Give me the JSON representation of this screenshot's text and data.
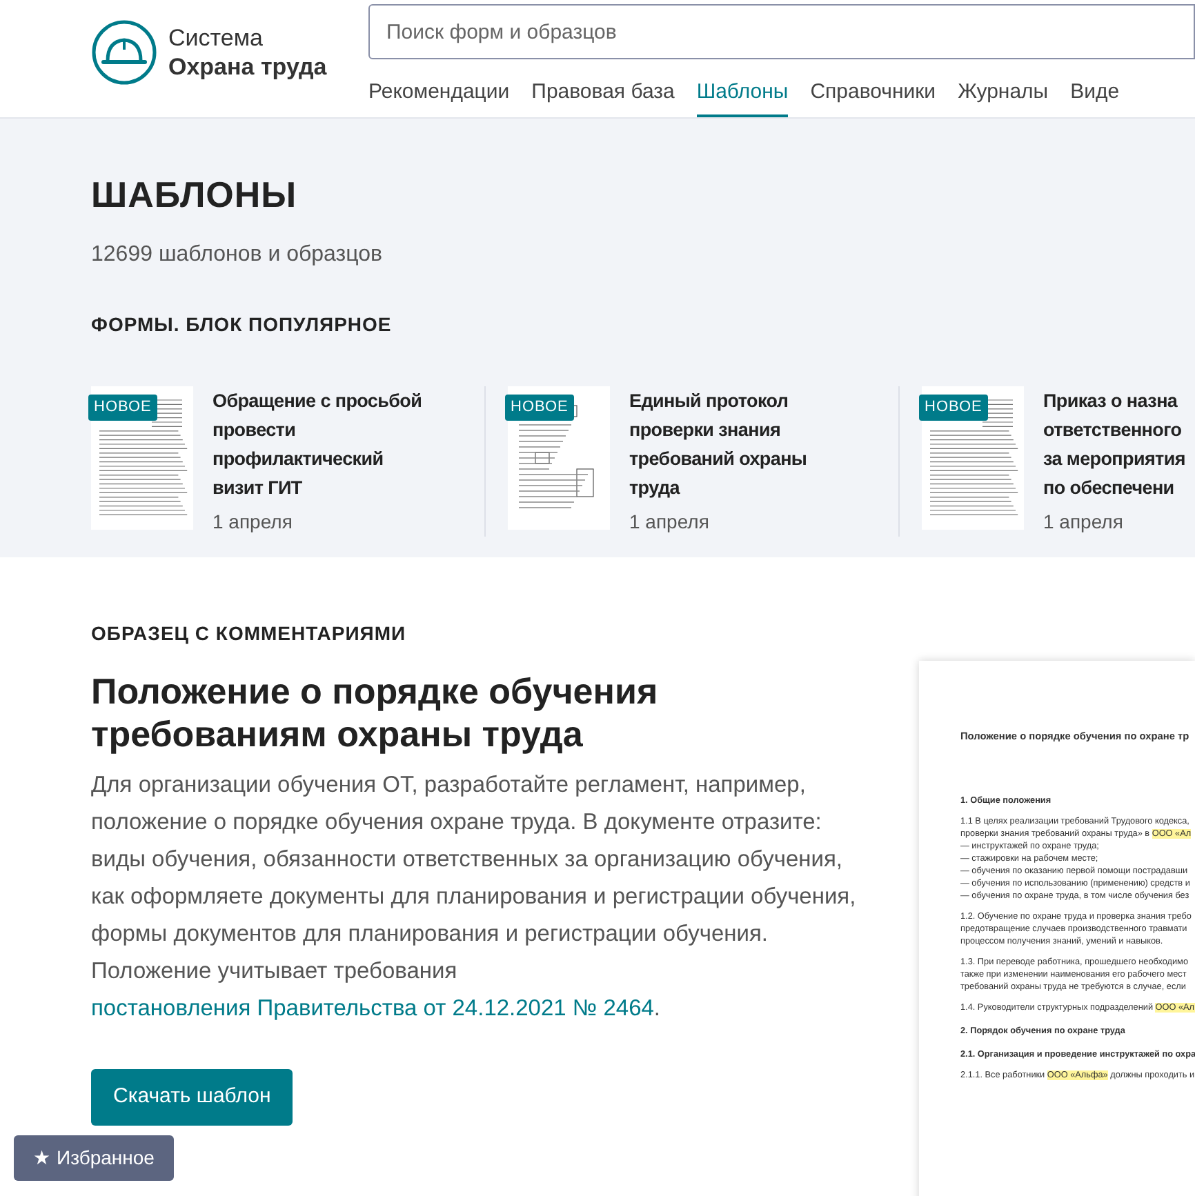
{
  "logo": {
    "line_1": "Система",
    "line_2": "Охрана труда"
  },
  "search": {
    "placeholder": "Поиск форм и образцов"
  },
  "nav": [
    {
      "label": "Рекомендации",
      "selected": false
    },
    {
      "label": "Правовая база",
      "selected": false
    },
    {
      "label": "Шаблоны",
      "selected": true
    },
    {
      "label": "Справочники",
      "selected": false
    },
    {
      "label": "Журналы",
      "selected": false
    },
    {
      "label": "Виде",
      "selected": false
    }
  ],
  "hero": {
    "title": "ШАБЛОНЫ",
    "count": "12699 шаблонов и образцов",
    "section_title": "ФОРМЫ. БЛОК ПОПУЛЯРНОЕ"
  },
  "cards": [
    {
      "badge": "НОВОЕ",
      "title_lines": [
        "Обращение с просьбой",
        "провести",
        "профилактический",
        "визит ГИТ"
      ],
      "date": "1 апреля",
      "kind": "letter"
    },
    {
      "badge": "НОВОЕ",
      "title_lines": [
        "Единый протокол",
        "проверки знания",
        "требований охраны",
        "труда"
      ],
      "date": "1 апреля",
      "kind": "form"
    },
    {
      "badge": "НОВОЕ",
      "title_lines": [
        "Приказ о назна",
        "ответственного",
        "за мероприятия",
        "по обеспечени"
      ],
      "date": "1 апреля",
      "kind": "letter"
    }
  ],
  "sample": {
    "label": "ОБРАЗЕЦ С КОММЕНТАРИЯМИ",
    "title": "Положение о порядке обучения требованиям охраны труда",
    "text": "Для организации обучения ОТ, разработайте регламент, например, положение о порядке обучения охране труда. В документе отразите: виды обучения, обязанности ответственных за организацию обучения, как оформляете документы для планирования и регистрации обучения, формы документов для планирования и регистрации обучения. Положение учитывает требования ",
    "link": "постановления Правительства от 24.12.2021 № 2464",
    "text_end": ".",
    "button": "Скачать шаблон"
  },
  "document": [
    {
      "kind": "title",
      "parts": [
        {
          "text": "Положение о порядке обучения по охране тр",
          "highlight": false
        }
      ]
    },
    {
      "kind": "heading",
      "parts": [
        {
          "text": "1. Общие положения",
          "highlight": false
        }
      ]
    },
    {
      "kind": "line",
      "parts": [
        {
          "text": "1.1 В целях реализации требований Трудового кодекса,",
          "highlight": false
        }
      ]
    },
    {
      "kind": "cont",
      "parts": [
        {
          "text": "проверки знания требований охраны труда» в ",
          "highlight": false
        },
        {
          "text": "ООО «Ал",
          "highlight": true
        }
      ]
    },
    {
      "kind": "item",
      "parts": [
        {
          "text": "— инструктажей по охране труда;",
          "highlight": false
        }
      ]
    },
    {
      "kind": "item",
      "parts": [
        {
          "text": "— стажировки на рабочем месте;",
          "highlight": false
        }
      ]
    },
    {
      "kind": "item",
      "parts": [
        {
          "text": "— обучения по оказанию первой помощи пострадавши",
          "highlight": false
        }
      ]
    },
    {
      "kind": "item",
      "parts": [
        {
          "text": "— обучения по использованию (применению) средств и",
          "highlight": false
        }
      ]
    },
    {
      "kind": "item",
      "parts": [
        {
          "text": "— обучения по охране труда, в том числе обучения без",
          "highlight": false
        }
      ]
    },
    {
      "kind": "line",
      "parts": [
        {
          "text": "1.2. Обучение по охране труда и проверка знания требо",
          "highlight": false
        }
      ]
    },
    {
      "kind": "cont",
      "parts": [
        {
          "text": "предотвращение случаев производственного травмати",
          "highlight": false
        }
      ]
    },
    {
      "kind": "cont",
      "parts": [
        {
          "text": "процессом получения знаний, умений и навыков.",
          "highlight": false
        }
      ]
    },
    {
      "kind": "line",
      "parts": [
        {
          "text": "1.3. При переводе работника, прошедшего необходимо",
          "highlight": false
        }
      ]
    },
    {
      "kind": "cont",
      "parts": [
        {
          "text": "также при изменении наименования его рабочего мест",
          "highlight": false
        }
      ]
    },
    {
      "kind": "cont",
      "parts": [
        {
          "text": "требований охраны труда не требуются в случае, если",
          "highlight": false
        }
      ]
    },
    {
      "kind": "line",
      "parts": [
        {
          "text": "1.4. Руководители структурных подразделений ",
          "highlight": false
        },
        {
          "text": "ООО «Ал",
          "highlight": true
        }
      ]
    },
    {
      "kind": "heading",
      "parts": [
        {
          "text": "2. Порядок обучения по охране труда",
          "highlight": false
        }
      ]
    },
    {
      "kind": "heading",
      "parts": [
        {
          "text": "2.1. Организация и проведение инструктажей по охра",
          "highlight": false
        }
      ]
    },
    {
      "kind": "line",
      "parts": [
        {
          "text": "2.1.1. Все работники ",
          "highlight": false
        },
        {
          "text": "ООО «Альфа»",
          "highlight": true
        },
        {
          "text": " должны проходить и",
          "highlight": false
        }
      ]
    }
  ],
  "favorites": {
    "icon": "★",
    "label": "Избранное"
  }
}
